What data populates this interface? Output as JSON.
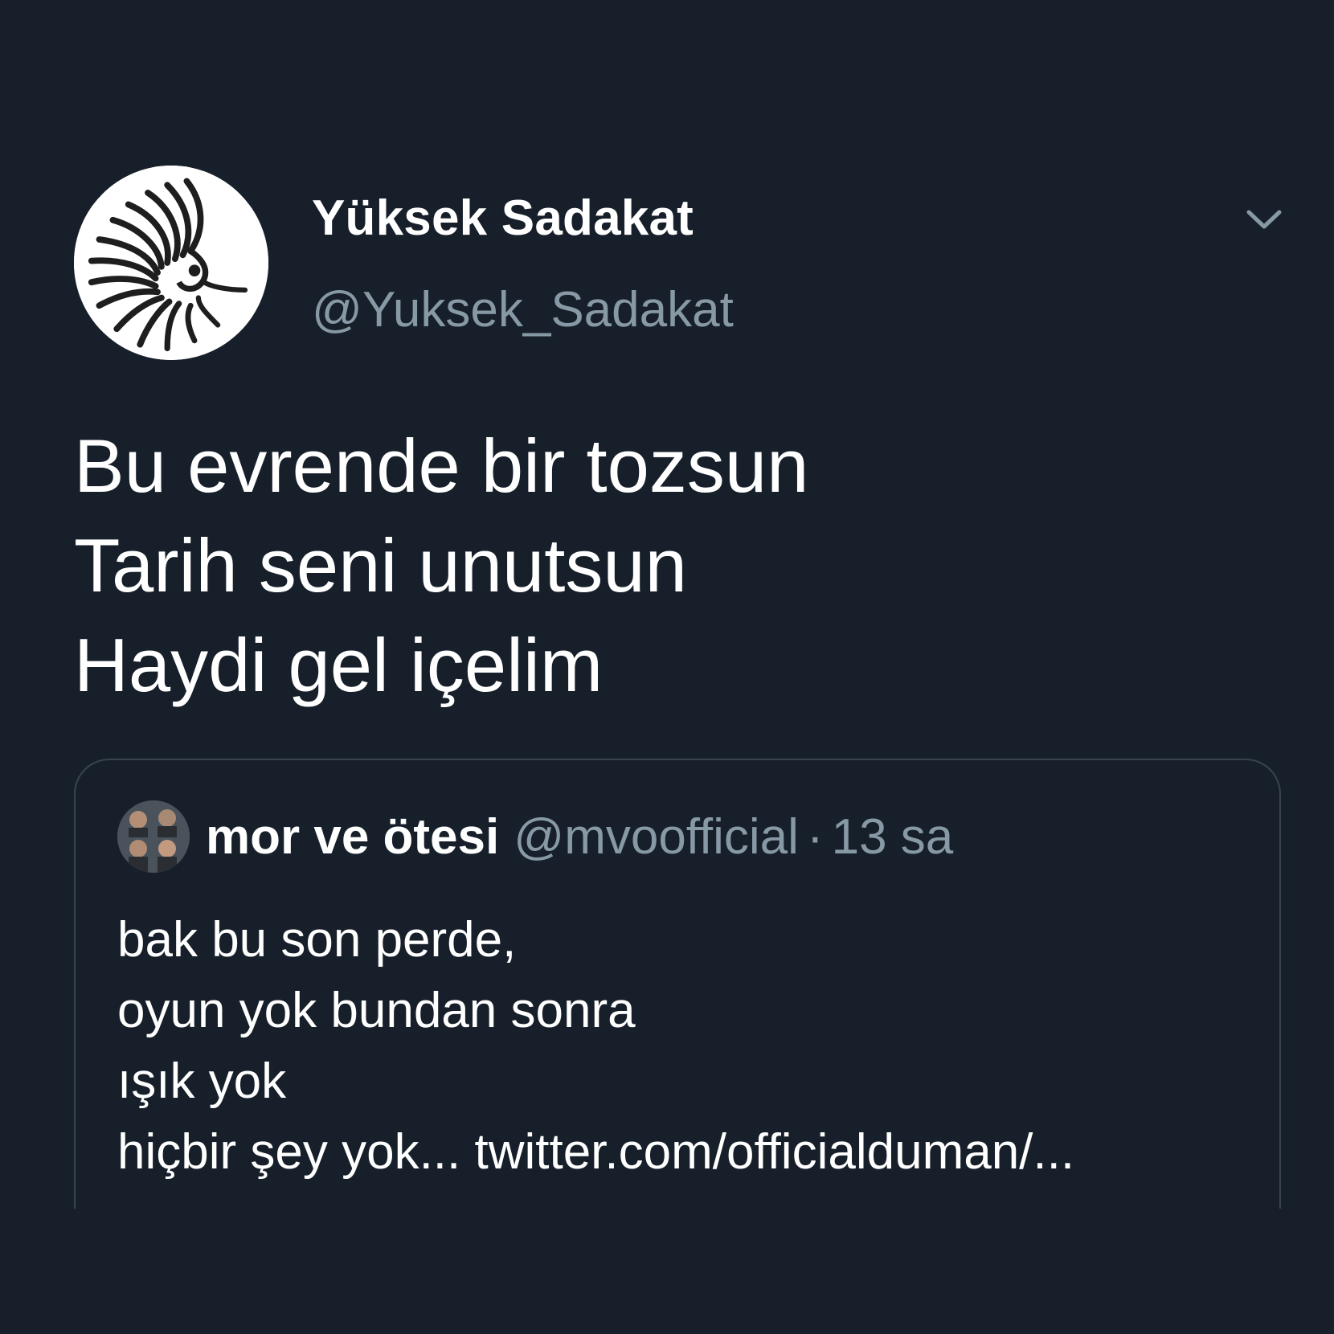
{
  "tweet": {
    "display_name": "Yüksek Sadakat",
    "handle": "@Yuksek_Sadakat",
    "menu_icon": "chevron-down-icon",
    "text_lines": [
      "Bu evrende bir tozsun",
      "Tarih seni unutsun",
      "Haydi gel içelim"
    ]
  },
  "quoted_tweet": {
    "display_name": "mor ve ötesi",
    "handle": "@mvoofficial",
    "separator": "·",
    "time": "13 sa",
    "text_lines": [
      "bak bu son perde,",
      "oyun yok bundan sonra",
      "ışık yok",
      "hiçbir şey yok... twitter.com/officialduman/..."
    ]
  },
  "colors": {
    "background": "#17202a",
    "primary_text": "#ffffff",
    "secondary_text": "#8899a6",
    "border": "#38444d"
  }
}
